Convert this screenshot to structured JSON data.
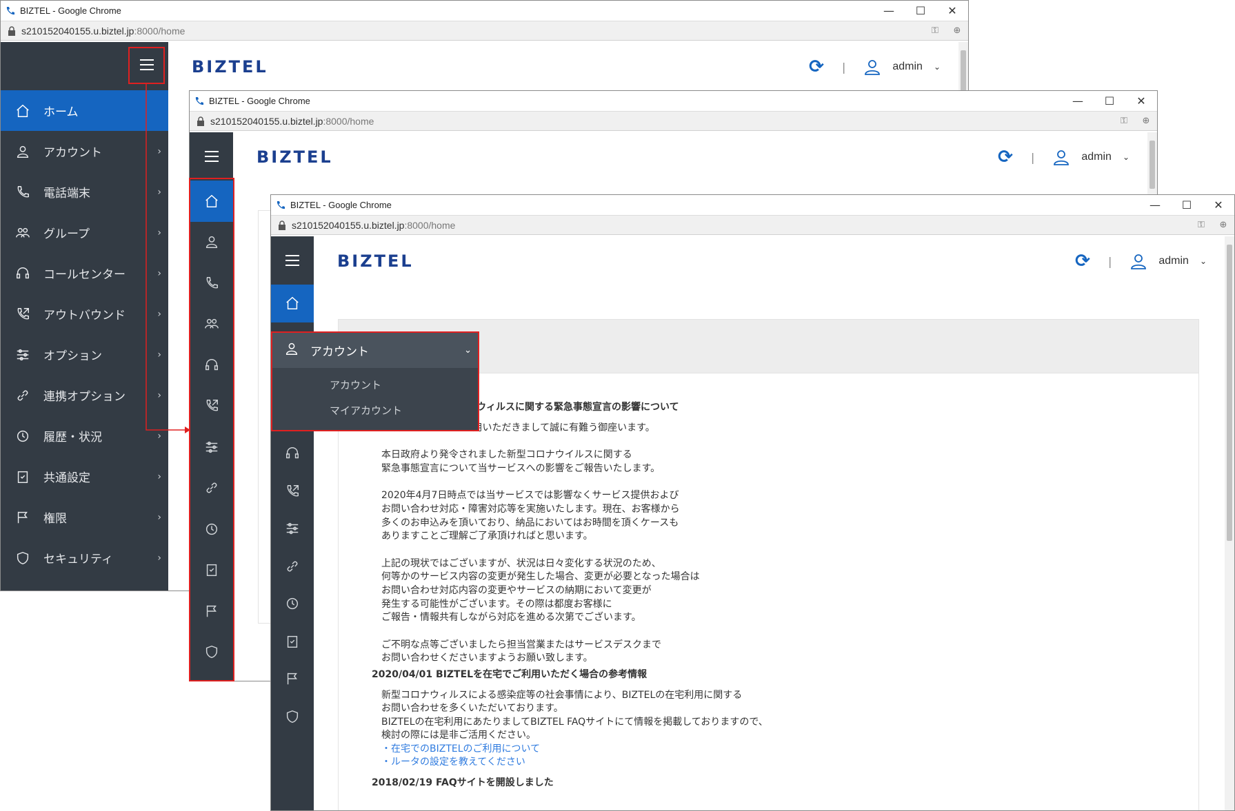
{
  "window1": {
    "title": "BIZTEL - Google Chrome",
    "url_host": "s210152040155.u.biztel.jp",
    "url_path": ":8000/home",
    "logo": "BIZTEL",
    "user": "admin",
    "nav": [
      {
        "label": "ホーム",
        "icon": "home-icon"
      },
      {
        "label": "アカウント",
        "icon": "user-icon"
      },
      {
        "label": "電話端末",
        "icon": "phone-icon"
      },
      {
        "label": "グループ",
        "icon": "group-icon"
      },
      {
        "label": "コールセンター",
        "icon": "headset-icon"
      },
      {
        "label": "アウトバウンド",
        "icon": "outbound-call-icon"
      },
      {
        "label": "オプション",
        "icon": "sliders-icon"
      },
      {
        "label": "連携オプション",
        "icon": "link-icon"
      },
      {
        "label": "履歴・状況",
        "icon": "history-icon"
      },
      {
        "label": "共通設定",
        "icon": "checklist-icon"
      },
      {
        "label": "権限",
        "icon": "flag-icon"
      },
      {
        "label": "セキュリティ",
        "icon": "shield-icon"
      }
    ]
  },
  "window2": {
    "title": "BIZTEL - Google Chrome",
    "url_host": "s210152040155.u.biztel.jp",
    "url_path": ":8000/home",
    "logo": "BIZTEL",
    "user": "admin"
  },
  "window3": {
    "title": "BIZTEL - Google Chrome",
    "url_host": "s210152040155.u.biztel.jp",
    "url_path": ":8000/home",
    "logo": "BIZTEL",
    "user": "admin",
    "dropdown": {
      "header": "アカウント",
      "items": [
        "アカウント",
        "マイアカウント"
      ]
    },
    "news": {
      "item1_title": "ウィルスに関する緊急事態宣言の影響について",
      "item1_intro": "日頃はBIZTELをご利用いただきまして誠に有難う御座います。",
      "item1_p1": [
        "本日政府より発令されました新型コロナウイルスに関する",
        "緊急事態宣言について当サービスへの影響をご報告いたします。"
      ],
      "item1_p2": [
        "2020年4月7日時点では当サービスでは影響なくサービス提供および",
        "お問い合わせ対応・障害対応等を実施いたします。現在、お客様から",
        "多くのお申込みを頂いており、納品においてはお時間を頂くケースも",
        "ありますことご理解ご了承頂ければと思います。"
      ],
      "item1_p3": [
        "上記の現状ではございますが、状況は日々変化する状況のため、",
        "何等かのサービス内容の変更が発生した場合、変更が必要となった場合は",
        "お問い合わせ対応内容の変更やサービスの納期において変更が",
        "発生する可能性がございます。その際は都度お客様に",
        "ご報告・情報共有しながら対応を進める次第でございます。"
      ],
      "item1_p4": [
        "ご不明な点等ございましたら担当営業またはサービスデスクまで",
        "お問い合わせくださいますようお願い致します。"
      ],
      "item2_title": "2020/04/01 BIZTELを在宅でご利用いただく場合の参考情報",
      "item2_p1": [
        "新型コロナウィルスによる感染症等の社会事情により、BIZTELの在宅利用に関する",
        "お問い合わせを多くいただいております。",
        "BIZTELの在宅利用にあたりましてBIZTEL FAQサイトにて情報を掲載しておりますので、",
        "検討の際には是非ご活用ください。"
      ],
      "item2_links": [
        "・在宅でのBIZTELのご利用について",
        "・ルータの設定を教えてください"
      ],
      "item3_title": "2018/02/19 FAQサイトを開設しました"
    }
  },
  "colors": {
    "accent": "#1565c0",
    "sidebar": "#333b44",
    "highlight": "#e02020",
    "link": "#2f7bdf",
    "logo": "#1b3f8f"
  }
}
